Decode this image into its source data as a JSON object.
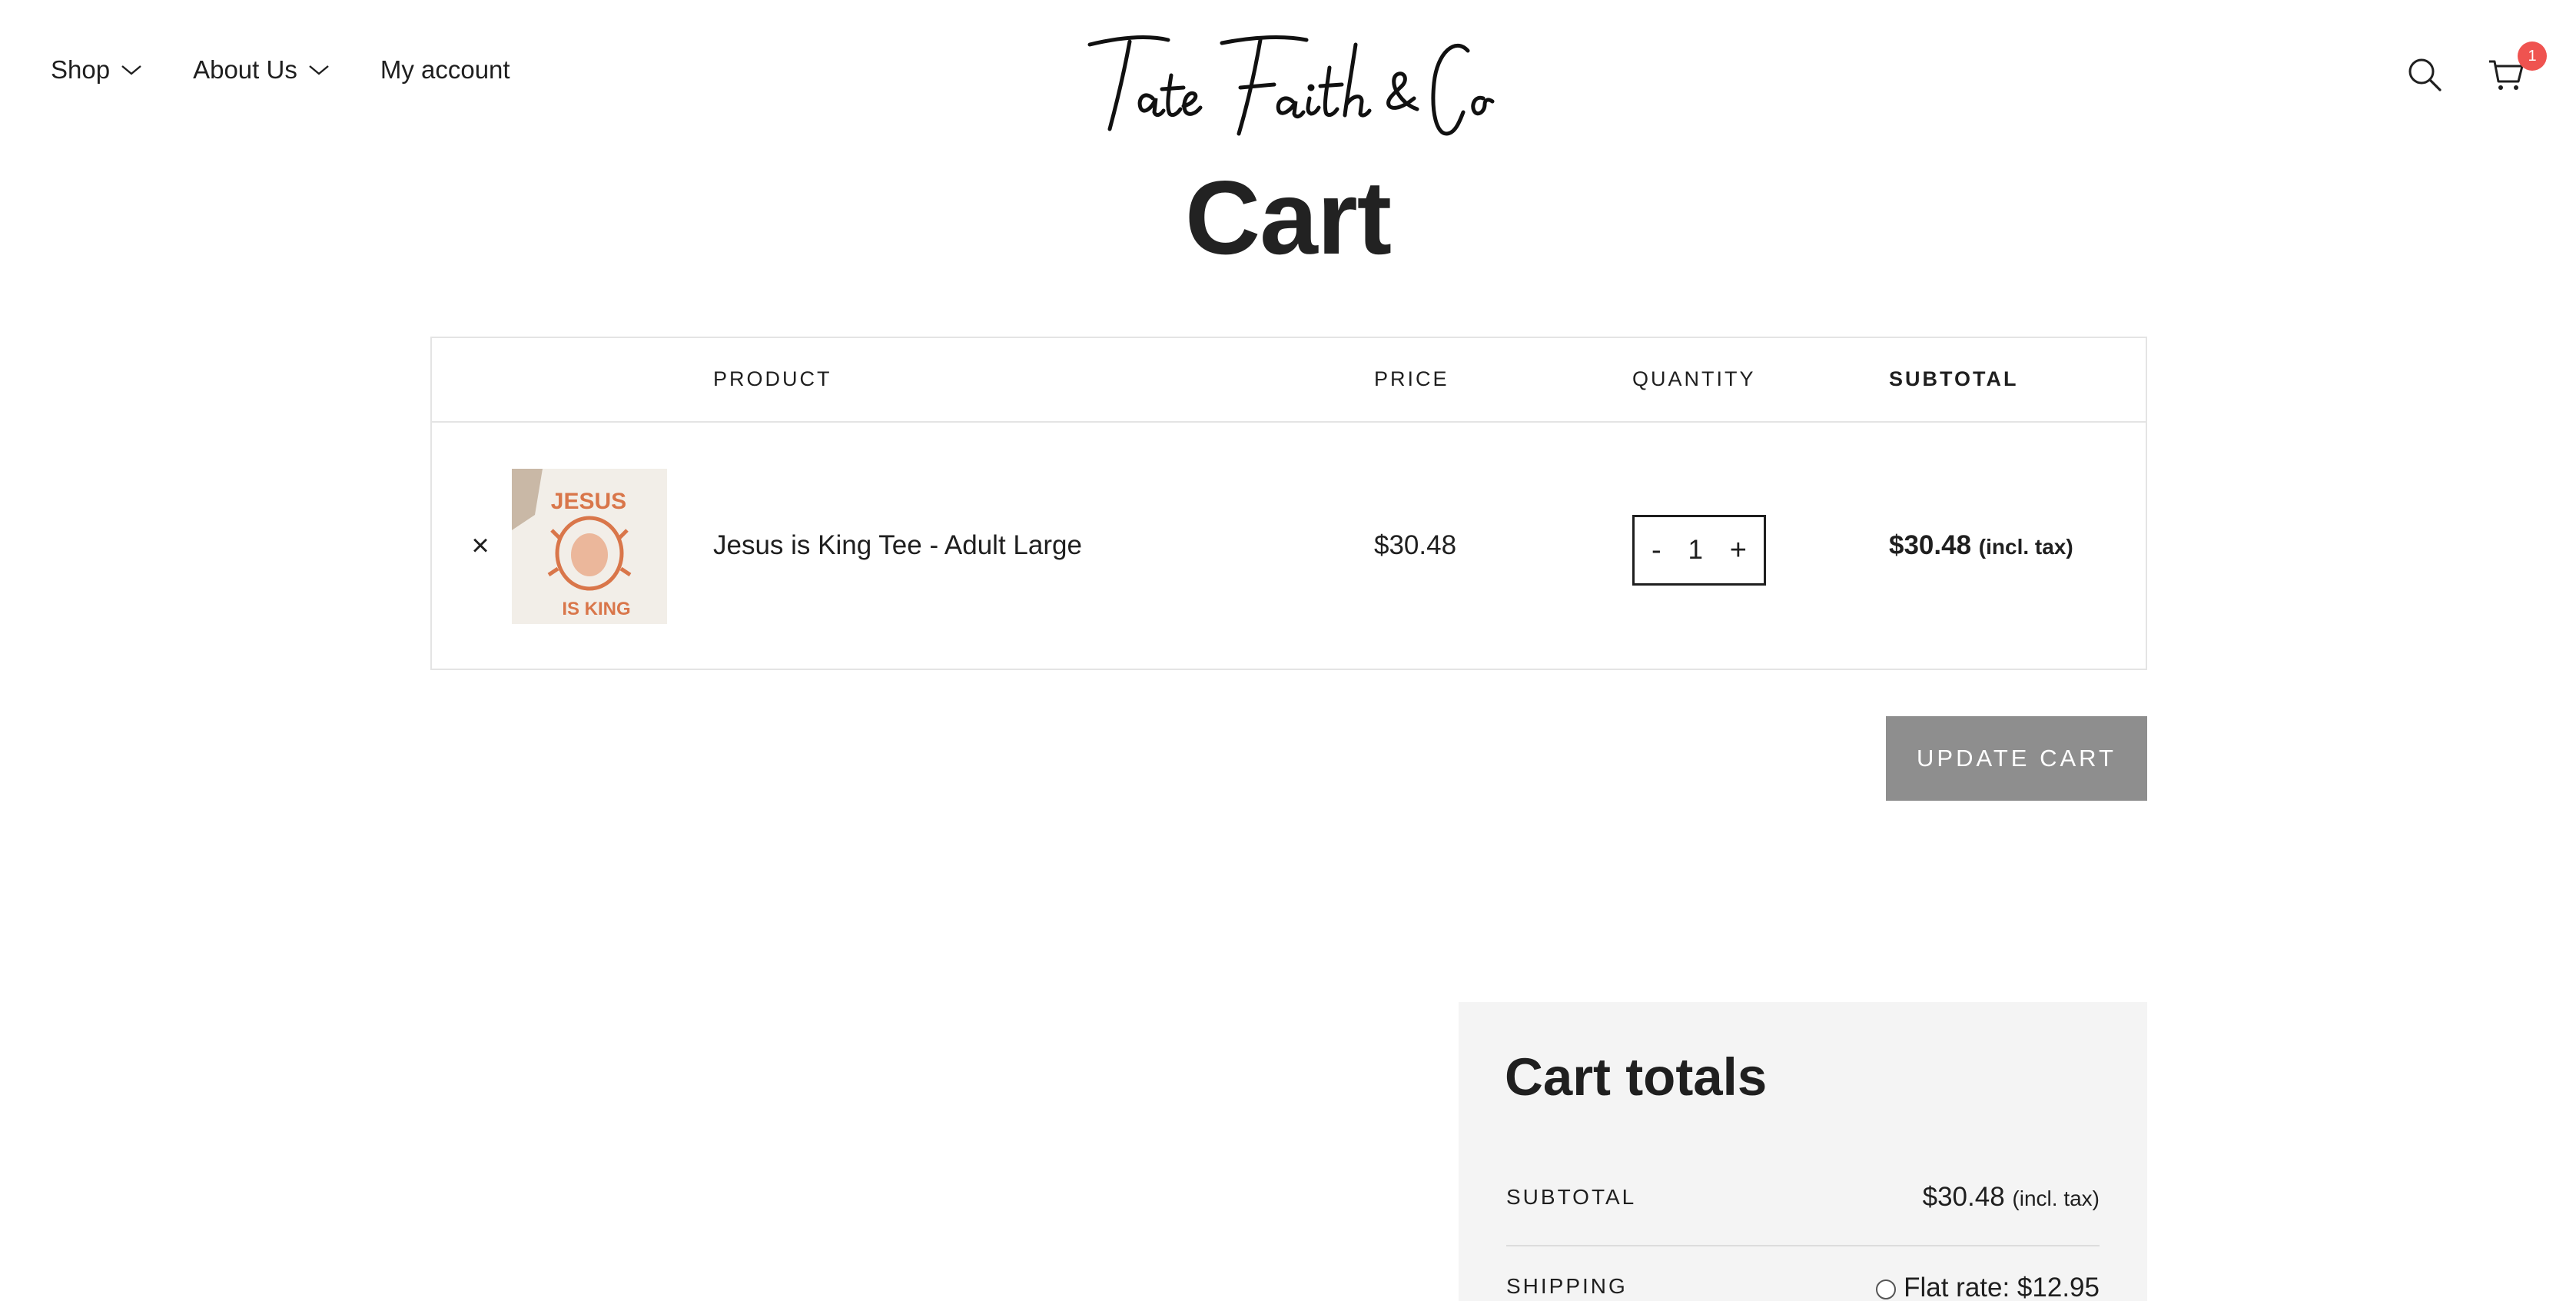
{
  "header": {
    "nav": [
      {
        "label": "Shop",
        "has_dropdown": true
      },
      {
        "label": "About Us",
        "has_dropdown": true
      },
      {
        "label": "My account",
        "has_dropdown": false
      }
    ],
    "logo_text": "Tate Faith & Co",
    "icons": [
      "search-icon",
      "cart-icon"
    ],
    "cart_count": "1",
    "badge_color": "#ef5350"
  },
  "page_title": "Cart",
  "table": {
    "headers": {
      "product": "PRODUCT",
      "price": "PRICE",
      "quantity": "QUANTITY",
      "subtotal": "SUBTOTAL"
    },
    "items": [
      {
        "remove_symbol": "×",
        "name": "Jesus is King Tee - Adult Large",
        "price": "$30.48",
        "quantity": "1",
        "qty_minus": "-",
        "qty_plus": "+",
        "subtotal": "$30.48",
        "subtotal_note": "(incl. tax)"
      }
    ]
  },
  "update_cart_label": "UPDATE CART",
  "totals": {
    "title": "Cart totals",
    "subtotal_label": "SUBTOTAL",
    "subtotal_value": "$30.48",
    "subtotal_note": "(incl. tax)",
    "shipping_label": "SHIPPING",
    "shipping_option": "Flat rate: $12.95"
  }
}
